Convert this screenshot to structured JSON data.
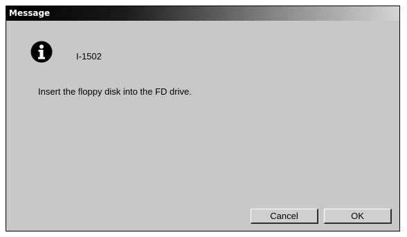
{
  "window": {
    "title": "Message"
  },
  "message": {
    "icon": "info-icon",
    "code": "I-1502",
    "text": "Insert the floppy disk into the FD drive."
  },
  "buttons": {
    "cancel_label": "Cancel",
    "ok_label": "OK"
  }
}
